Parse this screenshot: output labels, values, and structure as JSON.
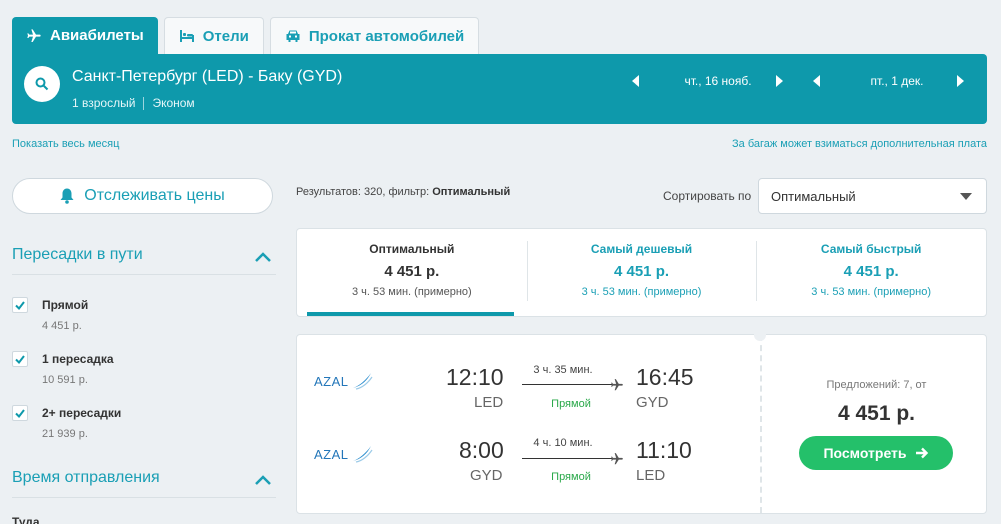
{
  "tabs": [
    {
      "label": "Авиабилеты",
      "icon": "plane-icon",
      "active": true
    },
    {
      "label": "Отели",
      "icon": "bed-icon",
      "active": false
    },
    {
      "label": "Прокат автомобилей",
      "icon": "car-icon",
      "active": false
    }
  ],
  "search": {
    "route": "Санкт-Петербург (LED) - Баку (GYD)",
    "passengers": "1 взрослый",
    "cabin_class": "Эконом",
    "depart_date": "чт., 16 нояб.",
    "return_date": "пт., 1 дек."
  },
  "links": {
    "show_month": "Показать весь месяц",
    "baggage_note": "За багаж может взиматься дополнительная плата"
  },
  "sidebar": {
    "track_prices": "Отслеживать цены",
    "stops_title": "Пересадки в пути",
    "stops": [
      {
        "label": "Прямой",
        "price": "4 451 р.",
        "checked": true
      },
      {
        "label": "1 пересадка",
        "price": "10 591 р.",
        "checked": true
      },
      {
        "label": "2+ пересадки",
        "price": "21 939 р.",
        "checked": true
      }
    ],
    "departure_title": "Время отправления",
    "departure_sub": "Туда"
  },
  "results": {
    "prefix": "Результатов: 320, фильтр: ",
    "filter": "Оптимальный",
    "sort_label": "Сортировать по",
    "sort_value": "Оптимальный"
  },
  "sort_tabs": [
    {
      "name": "Оптимальный",
      "price": "4 451 р.",
      "duration": "3 ч. 53 мин. (примерно)",
      "active": true
    },
    {
      "name": "Самый дешевый",
      "price": "4 451 р.",
      "duration": "3 ч. 53 мин. (примерно)",
      "active": false
    },
    {
      "name": "Самый быстрый",
      "price": "4 451 р.",
      "duration": "3 ч. 53 мин. (примерно)",
      "active": false
    }
  ],
  "ticket": {
    "legs": [
      {
        "airline": "AZAL",
        "dep_time": "12:10",
        "dep_code": "LED",
        "arr_time": "16:45",
        "arr_code": "GYD",
        "duration": "3 ч. 35 мин.",
        "stops": "Прямой"
      },
      {
        "airline": "AZAL",
        "dep_time": "8:00",
        "dep_code": "GYD",
        "arr_time": "11:10",
        "arr_code": "LED",
        "duration": "4 ч. 10 мин.",
        "stops": "Прямой"
      }
    ],
    "offers": "Предложений: 7, от",
    "price": "4 451 р.",
    "view_button": "Посмотреть"
  },
  "colors": {
    "brand": "#0e99ab",
    "link": "#1a9fb5",
    "cta": "#24c06a",
    "direct": "#2aa84a",
    "background": "#ecf0f3"
  }
}
